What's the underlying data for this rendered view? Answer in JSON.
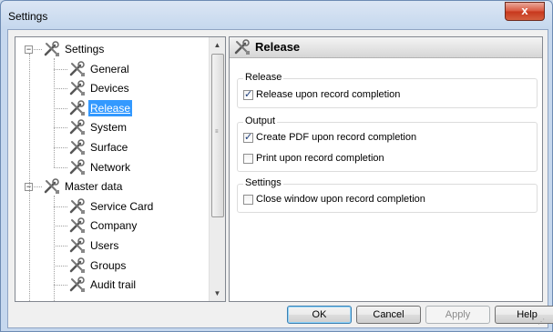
{
  "window": {
    "title": "Settings",
    "close_label": "x"
  },
  "tree": {
    "items": [
      {
        "label": "Settings",
        "level": 0,
        "expanded": true
      },
      {
        "label": "General",
        "level": 1
      },
      {
        "label": "Devices",
        "level": 1
      },
      {
        "label": "Release",
        "level": 1,
        "selected": true
      },
      {
        "label": "System",
        "level": 1
      },
      {
        "label": "Surface",
        "level": 1
      },
      {
        "label": "Network",
        "level": 1
      },
      {
        "label": "Master data",
        "level": 0,
        "expanded": true
      },
      {
        "label": "Service Card",
        "level": 1
      },
      {
        "label": "Company",
        "level": 1
      },
      {
        "label": "Users",
        "level": 1
      },
      {
        "label": "Groups",
        "level": 1
      },
      {
        "label": "Audit trail",
        "level": 1
      }
    ]
  },
  "panel": {
    "title": "Release",
    "groups": [
      {
        "legend": "Release",
        "options": [
          {
            "label": "Release upon record completion",
            "checked": true
          }
        ]
      },
      {
        "legend": "Output",
        "options": [
          {
            "label": "Create PDF upon record completion",
            "checked": true
          },
          {
            "label": "Print upon record completion",
            "checked": false
          }
        ]
      },
      {
        "legend": "Settings",
        "options": [
          {
            "label": "Close window upon record completion",
            "checked": false
          }
        ]
      }
    ]
  },
  "buttons": {
    "ok": "OK",
    "cancel": "Cancel",
    "apply": "Apply",
    "help": "Help"
  },
  "icons": {
    "tree_item": "tools-icon",
    "expander": "collapse-icon"
  },
  "colors": {
    "selection": "#3399ff",
    "close": "#d8553c"
  }
}
